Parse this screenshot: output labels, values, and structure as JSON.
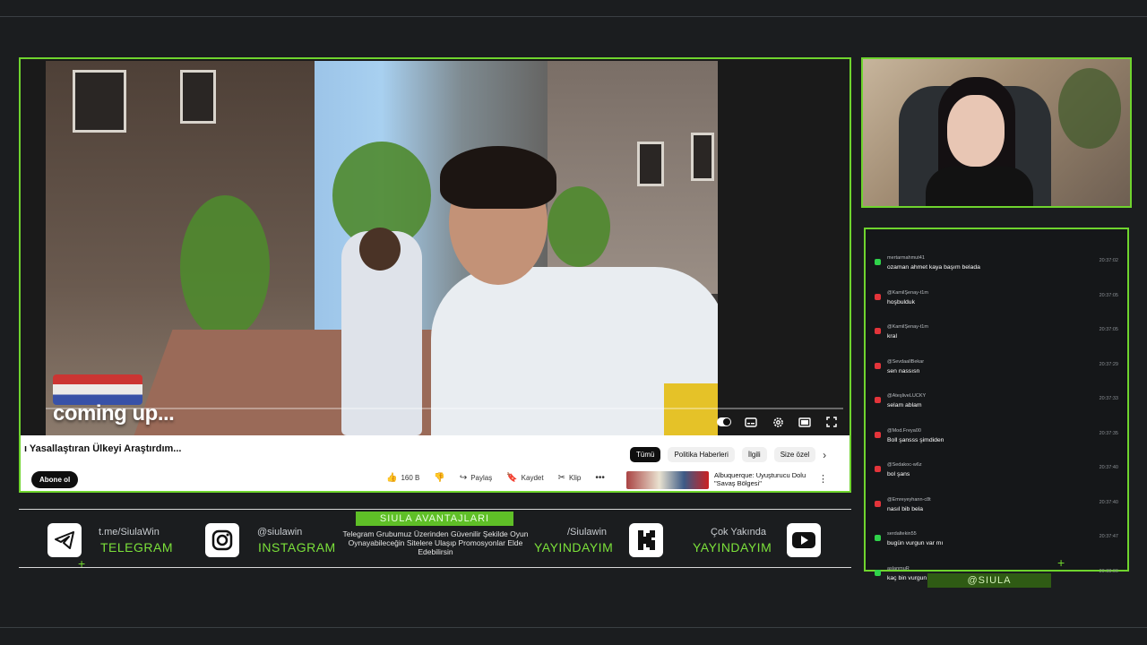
{
  "video": {
    "overlay_text": "coming up...",
    "title": "ı Yasallaştıran Ülkeyi Araştırdım..."
  },
  "chips": [
    "Tümü",
    "Politika Haberleri",
    "İlgili",
    "Size özel"
  ],
  "channel": {
    "subscribe_label": "Abone ol"
  },
  "actions": {
    "like_count": "160 B",
    "share_label": "Paylaş",
    "save_label": "Kaydet",
    "clip_label": "Klip"
  },
  "related": {
    "title": "Albuquerque: Uyuşturucu Dolu \"Savaş Bölgesi\""
  },
  "chat": [
    {
      "user": "mertarmahmut41",
      "time": "20:37:02",
      "text": "ozaman ahmet kaya başım belada",
      "badge": "green"
    },
    {
      "user": "@KamilŞenay-t1m",
      "time": "20:37:05",
      "text": "hoşbulduk",
      "badge": "red"
    },
    {
      "user": "@KamilŞenay-t1m",
      "time": "20:37:05",
      "text": "kral",
      "badge": "red"
    },
    {
      "user": "@SevdaallBekar",
      "time": "20:37:29",
      "text": "sen nassısn",
      "badge": "red"
    },
    {
      "user": "@AteşliveLUCKY",
      "time": "20:37:33",
      "text": "selam ablam",
      "badge": "red"
    },
    {
      "user": "@Mod.Freya00",
      "time": "20:37:35",
      "text": "Boll şansss şimdiden",
      "badge": "red"
    },
    {
      "user": "@Sedakoc-w6z",
      "time": "20:37:40",
      "text": "bol şans",
      "badge": "red"
    },
    {
      "user": "@Emreyeyhann-c8t",
      "time": "20:37:40",
      "text": "nasıl bib bela",
      "badge": "red"
    },
    {
      "user": "serdaltekin55",
      "time": "20:37:47",
      "text": "bugün vurgun var mı",
      "badge": "green"
    },
    {
      "user": "aslanmuR",
      "time": "20:38:00",
      "text": "kaç bin vurgun olur tahminleri alaalım millleeeettttt",
      "badge": "green"
    }
  ],
  "handle_tag": "@SIULA",
  "footer": {
    "telegram_small": "t.me/SiulaWin",
    "telegram_big": "TELEGRAM",
    "instagram_small": "@siulawin",
    "instagram_big": "INSTAGRAM",
    "promo_title": "SIULA AVANTAJLARI",
    "promo_text": "Telegram Grubumuz Üzerinden Güvenilir Şekilde Oyun Oynayabileceğin Sitelere Ulaşıp Promosyonlar Elde Edebilirsin",
    "kick_small": "/Siulawin",
    "kick_big": "YAYINDAYIM",
    "youtube_small": "Çok Yakında",
    "youtube_big": "YAYINDAYIM"
  },
  "colors": {
    "accent": "#6fd42e",
    "background": "#1b1d1f",
    "badge_green": "#2fd24a",
    "badge_red": "#e3343a"
  }
}
